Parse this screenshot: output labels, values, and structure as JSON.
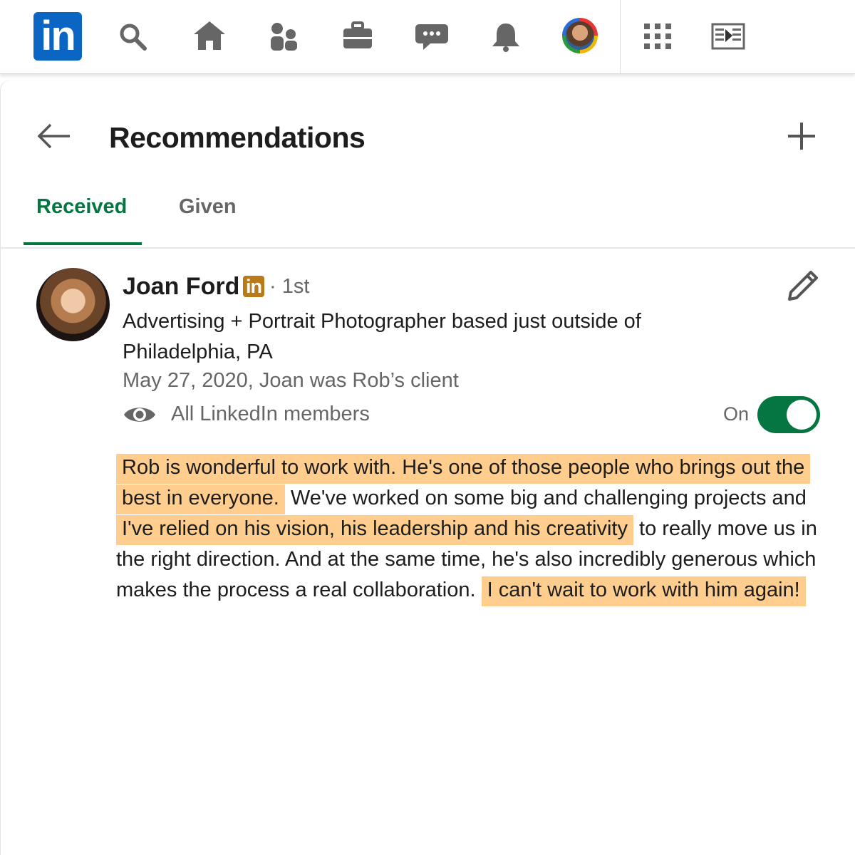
{
  "nav": {
    "logo_text": "in",
    "icons": [
      "search-icon",
      "home-icon",
      "my-network-icon",
      "jobs-icon",
      "messaging-icon",
      "notifications-icon",
      "me-avatar",
      "apps-grid-icon",
      "learning-video-icon"
    ]
  },
  "header": {
    "title": "Recommendations"
  },
  "tabs": [
    {
      "label": "Received",
      "active": true
    },
    {
      "label": "Given",
      "active": false
    }
  ],
  "recommendation": {
    "name": "Joan Ford",
    "badge": "in",
    "degree": "· 1st",
    "headline": "Advertising + Portrait Photographer based just outside of Philadelphia, PA",
    "meta": "May 27, 2020, Joan was Rob’s client",
    "visibility": "All LinkedIn members",
    "toggle_label": "On",
    "toggle_on": true,
    "text": {
      "h1": "Rob is wonderful to work with. He's one of those people who brings out the best in everyone.",
      "p1": "We've worked on some big and challenging projects and",
      "h2": "I've relied on his vision, his leadership and his creativity",
      "p2": "to really move us in the right direction. And at the same time, he's also incredibly generous which makes the process a real collaboration.",
      "h3": "I can't wait to work with him again!"
    }
  },
  "colors": {
    "brand": "#0a66c2",
    "active_tab": "#057642",
    "highlight": "#ffce8f",
    "badge": "#b87a1a"
  }
}
